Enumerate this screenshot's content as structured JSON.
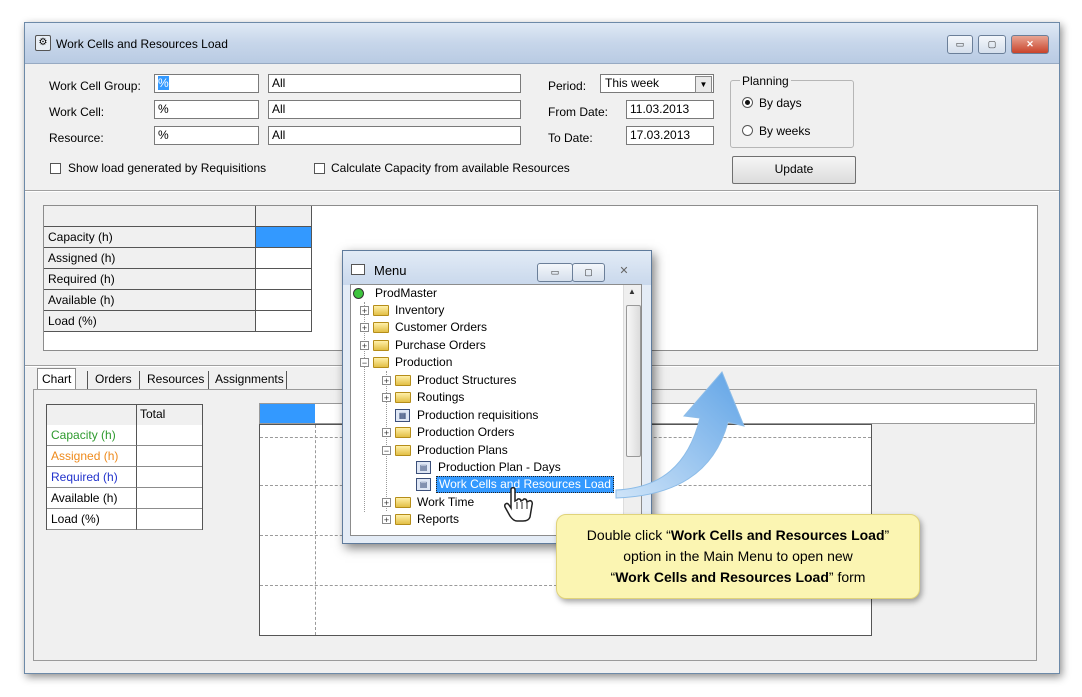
{
  "window": {
    "title": "Work Cells and Resources Load",
    "controls": {
      "minimize": "▭",
      "maximize": "▢",
      "close": "✕"
    }
  },
  "filters": {
    "work_cell_group": {
      "label": "Work Cell Group:",
      "code": "%",
      "name": "All"
    },
    "work_cell": {
      "label": "Work Cell:",
      "code": "%",
      "name": "All"
    },
    "resource": {
      "label": "Resource:",
      "code": "%",
      "name": "All"
    },
    "period": {
      "label": "Period:",
      "value": "This week"
    },
    "from_date": {
      "label": "From Date:",
      "value": "11.03.2013"
    },
    "to_date": {
      "label": "To Date:",
      "value": "17.03.2013"
    },
    "show_requisitions": "Show load generated by Requisitions",
    "calc_capacity": "Calculate Capacity from available Resources"
  },
  "planning": {
    "title": "Planning",
    "by_days": "By days",
    "by_weeks": "By weeks",
    "selected": "By days"
  },
  "update_button": "Update",
  "summary_rows": [
    "Capacity (h)",
    "Assigned (h)",
    "Required (h)",
    "Available (h)",
    "Load (%)"
  ],
  "tabs": [
    "Chart",
    "Orders",
    "Resources",
    "Assignments"
  ],
  "chart_table": {
    "header": "Total",
    "rows": [
      {
        "label": "Capacity (h)",
        "color": "#2e9a2e"
      },
      {
        "label": "Assigned (h)",
        "color": "#ee8a1c"
      },
      {
        "label": "Required (h)",
        "color": "#2233cc"
      },
      {
        "label": "Available (h)",
        "color": "#000000"
      },
      {
        "label": "Load (%)",
        "color": "#000000"
      }
    ]
  },
  "menu": {
    "title": "Menu",
    "root": "ProdMaster",
    "items": {
      "inventory": "Inventory",
      "customer_orders": "Customer Orders",
      "purchase_orders": "Purchase Orders",
      "production": "Production",
      "product_structures": "Product Structures",
      "routings": "Routings",
      "production_requisitions": "Production requisitions",
      "production_orders": "Production Orders",
      "production_plans": "Production Plans",
      "production_plan_days": "Production Plan - Days",
      "work_cells_resources_load": "Work Cells and Resources Load",
      "work_time": "Work Time",
      "reports": "Reports"
    }
  },
  "callout": {
    "t1": "Double click “",
    "b1": "Work Cells and Resources Load",
    "t2": "”",
    "t3": "option in the Main Menu to open new",
    "t4": "“",
    "b2": "Work Cells and Resources Load",
    "t5": "” form"
  },
  "colors": {
    "accent": "#3399ff",
    "arrow": "#7fb6ea",
    "callout_bg": "#fbf5b2"
  }
}
